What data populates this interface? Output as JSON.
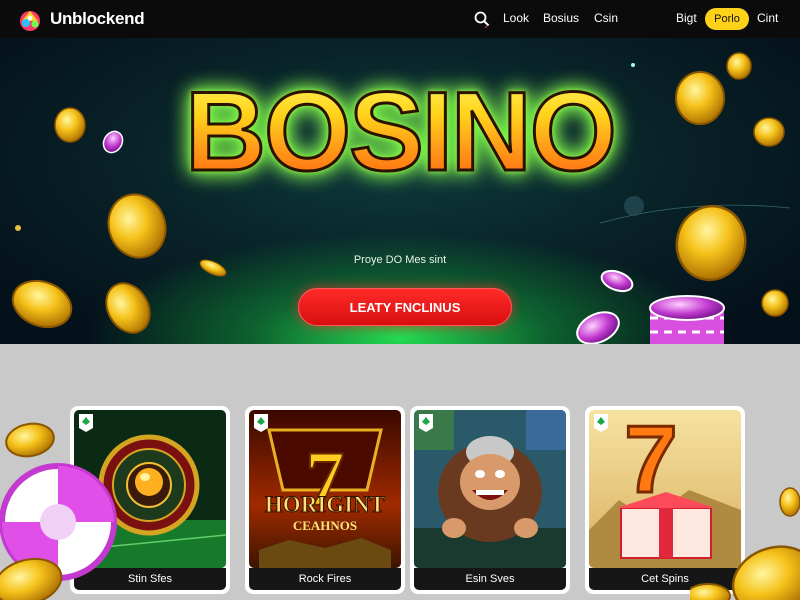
{
  "header": {
    "brand": "Unblockend",
    "nav": [
      "Look",
      "Bosius",
      "Csin"
    ],
    "right_links": [
      "Bigt",
      "Cint"
    ],
    "login_label": "Porlo"
  },
  "hero": {
    "title": "BOSINO",
    "subtitle": "Proye DO Mes sint",
    "cta_label": "LEATY FNCLINUS"
  },
  "games": [
    {
      "caption": "Stin Sfes"
    },
    {
      "caption": "Rock Fires",
      "art_line1": "HORIGINT",
      "art_line2": "CEAHNOS",
      "art_numeral": "7"
    },
    {
      "caption": "Esin Sves"
    },
    {
      "caption": "Cet Spins",
      "art_numeral": "7"
    }
  ],
  "colors": {
    "accent_yellow": "#ffd21a",
    "cta_red": "#e01414",
    "glow_green": "#2cff5a",
    "header_bg": "#0b0b0b",
    "games_bg": "#c9c9c9"
  },
  "icons": [
    "logo-icon",
    "search-icon",
    "game-badge-icon",
    "coin-icon",
    "casino-chip-icon"
  ]
}
